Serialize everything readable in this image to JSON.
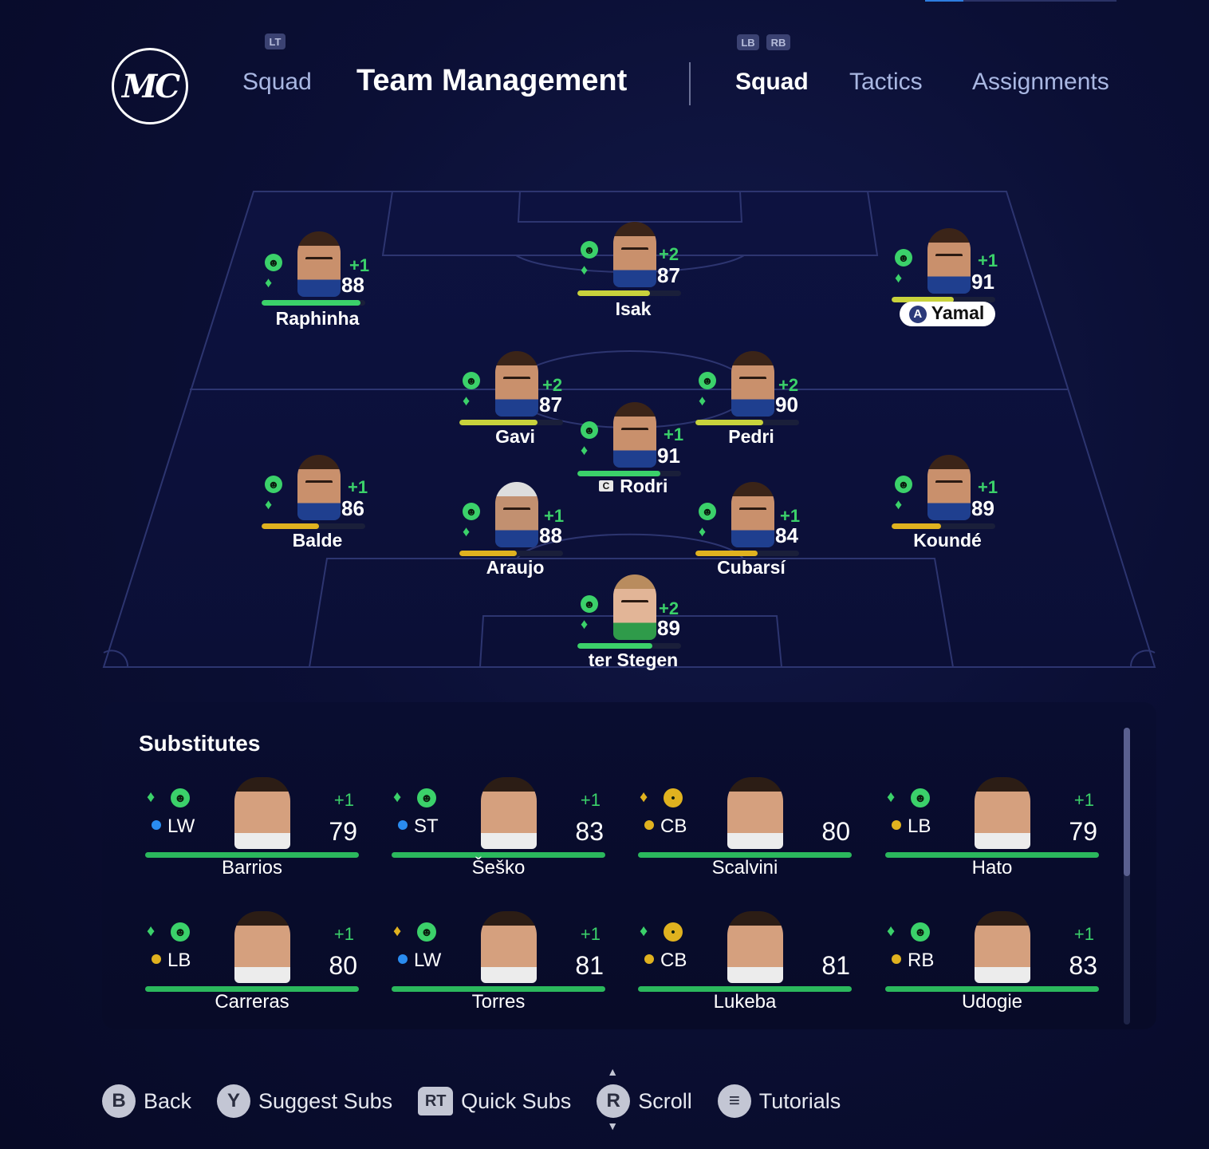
{
  "header": {
    "logo_text": "MC",
    "lt_hint": "LT",
    "squad_label": "Squad",
    "title": "Team Management",
    "lb_hint": "LB",
    "rb_hint": "RB",
    "tabs": [
      {
        "label": "Squad",
        "active": true
      },
      {
        "label": "Tactics",
        "active": false
      },
      {
        "label": "Assignments",
        "active": false
      }
    ]
  },
  "lineup": [
    {
      "name": "Raphinha",
      "plus": "+1",
      "ovr": "88",
      "fitness": 0.95,
      "bar_color": "#3bd16a"
    },
    {
      "name": "Isak",
      "plus": "+2",
      "ovr": "87",
      "fitness": 0.7,
      "bar_color": "#c8d23c"
    },
    {
      "name": "Yamal",
      "plus": "+1",
      "ovr": "91",
      "fitness": 0.6,
      "bar_color": "#c8d23c",
      "badge": "A"
    },
    {
      "name": "Gavi",
      "plus": "+2",
      "ovr": "87",
      "fitness": 0.75,
      "bar_color": "#c8d23c"
    },
    {
      "name": "Pedri",
      "plus": "+2",
      "ovr": "90",
      "fitness": 0.65,
      "bar_color": "#c8d23c"
    },
    {
      "name": "Rodri",
      "plus": "+1",
      "ovr": "91",
      "fitness": 0.8,
      "bar_color": "#3bd16a",
      "badge": "C"
    },
    {
      "name": "Balde",
      "plus": "+1",
      "ovr": "86",
      "fitness": 0.55,
      "bar_color": "#e0b21f"
    },
    {
      "name": "Araujo",
      "plus": "+1",
      "ovr": "88",
      "fitness": 0.55,
      "bar_color": "#e0b21f"
    },
    {
      "name": "Cubarsí",
      "plus": "+1",
      "ovr": "84",
      "fitness": 0.6,
      "bar_color": "#e0b21f"
    },
    {
      "name": "Koundé",
      "plus": "+1",
      "ovr": "89",
      "fitness": 0.48,
      "bar_color": "#e0b21f"
    },
    {
      "name": "ter Stegen",
      "plus": "+2",
      "ovr": "89",
      "fitness": 0.72,
      "bar_color": "#3bd16a"
    }
  ],
  "substitutes": {
    "title": "Substitutes",
    "players": [
      {
        "name": "Barrios",
        "pos": "LW",
        "pos_color": "#2a8cf0",
        "ovr": "79",
        "plus": "+1",
        "gem_color": "#3bd16a",
        "mood": "happy"
      },
      {
        "name": "Šeško",
        "pos": "ST",
        "pos_color": "#2a8cf0",
        "ovr": "83",
        "plus": "+1",
        "gem_color": "#3bd16a",
        "mood": "happy"
      },
      {
        "name": "Scalvini",
        "pos": "CB",
        "pos_color": "#e0b21f",
        "ovr": "80",
        "plus": "",
        "gem_color": "#e0b21f",
        "mood": "neutral"
      },
      {
        "name": "Hato",
        "pos": "LB",
        "pos_color": "#e0b21f",
        "ovr": "79",
        "plus": "+1",
        "gem_color": "#3bd16a",
        "mood": "happy"
      },
      {
        "name": "Carreras",
        "pos": "LB",
        "pos_color": "#e0b21f",
        "ovr": "80",
        "plus": "+1",
        "gem_color": "#3bd16a",
        "mood": "happy"
      },
      {
        "name": "Torres",
        "pos": "LW",
        "pos_color": "#2a8cf0",
        "ovr": "81",
        "plus": "+1",
        "gem_color": "#e0b21f",
        "mood": "happy"
      },
      {
        "name": "Lukeba",
        "pos": "CB",
        "pos_color": "#e0b21f",
        "ovr": "81",
        "plus": "",
        "gem_color": "#3bd16a",
        "mood": "neutral"
      },
      {
        "name": "Udogie",
        "pos": "RB",
        "pos_color": "#e0b21f",
        "ovr": "83",
        "plus": "+1",
        "gem_color": "#3bd16a",
        "mood": "happy"
      }
    ]
  },
  "footer": [
    {
      "icon": "B",
      "label": "Back"
    },
    {
      "icon": "Y",
      "label": "Suggest Subs"
    },
    {
      "icon": "RT",
      "label": "Quick Subs"
    },
    {
      "icon": "R",
      "label": "Scroll"
    },
    {
      "icon": "≡",
      "label": "Tutorials"
    }
  ]
}
